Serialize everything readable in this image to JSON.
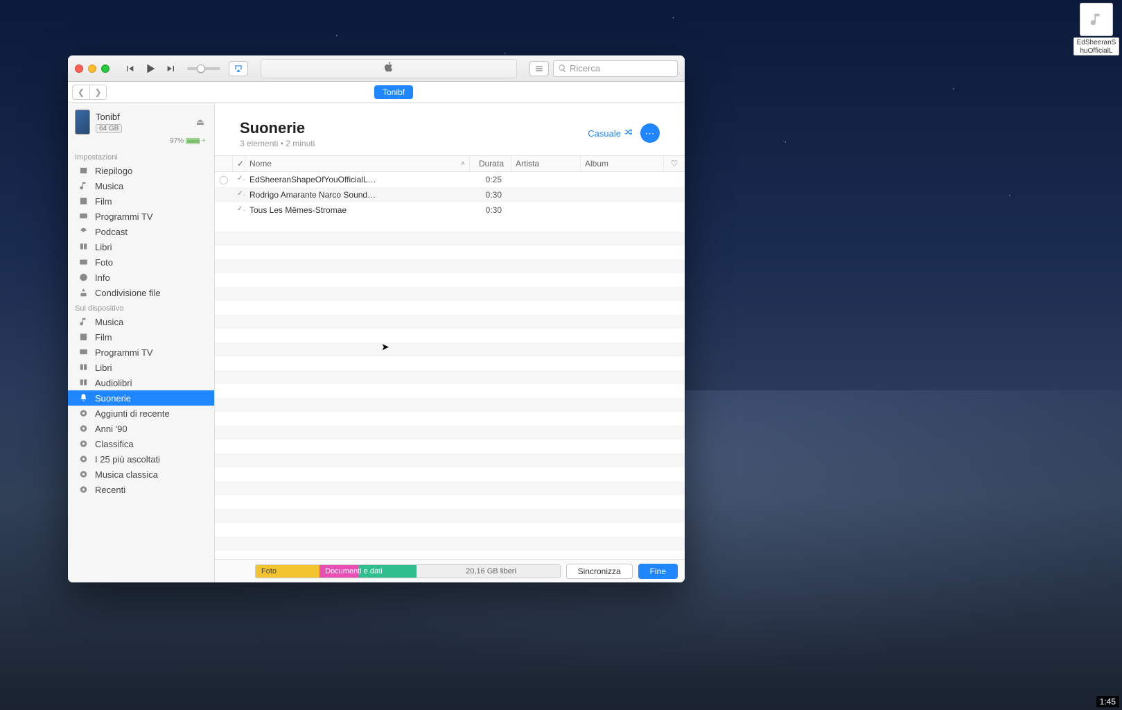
{
  "breadcrumb": {
    "device_pill": "Tonibf"
  },
  "device": {
    "name": "Tonibf",
    "capacity": "64 GB",
    "battery_pct": "97%"
  },
  "search": {
    "placeholder": "Ricerca"
  },
  "sidebar": {
    "section_settings": "Impostazioni",
    "section_on_device": "Sul dispositivo",
    "settings": [
      {
        "label": "Riepilogo"
      },
      {
        "label": "Musica"
      },
      {
        "label": "Film"
      },
      {
        "label": "Programmi TV"
      },
      {
        "label": "Podcast"
      },
      {
        "label": "Libri"
      },
      {
        "label": "Foto"
      },
      {
        "label": "Info"
      },
      {
        "label": "Condivisione file"
      }
    ],
    "on_device": [
      {
        "label": "Musica"
      },
      {
        "label": "Film"
      },
      {
        "label": "Programmi TV"
      },
      {
        "label": "Libri"
      },
      {
        "label": "Audiolibri"
      },
      {
        "label": "Suonerie"
      },
      {
        "label": "Aggiunti di recente"
      },
      {
        "label": "Anni '90"
      },
      {
        "label": "Classifica"
      },
      {
        "label": "I 25 più ascoltati"
      },
      {
        "label": "Musica classica"
      },
      {
        "label": "Recenti"
      }
    ]
  },
  "page": {
    "title": "Suonerie",
    "subtitle": "3 elementi • 2 minuti",
    "shuffle_label": "Casuale"
  },
  "columns": {
    "check": "✓",
    "name": "Nome",
    "duration": "Durata",
    "artist": "Artista",
    "album": "Album"
  },
  "rows": [
    {
      "name": "EdSheeranShapeOfYouOfficialL…",
      "duration": "0:25"
    },
    {
      "name": "Rodrigo Amarante Narco Sound…",
      "duration": "0:30"
    },
    {
      "name": "Tous Les Mêmes-Stromae",
      "duration": "0:30"
    }
  ],
  "storage": {
    "foto": "Foto",
    "docs": "Documenti e dati",
    "free": "20,16 GB liberi"
  },
  "footer": {
    "sync": "Sincronizza",
    "done": "Fine"
  },
  "desktop_file": {
    "name": "EdSheeranShuOfficialLy…Vi"
  },
  "video_time": "1:45"
}
